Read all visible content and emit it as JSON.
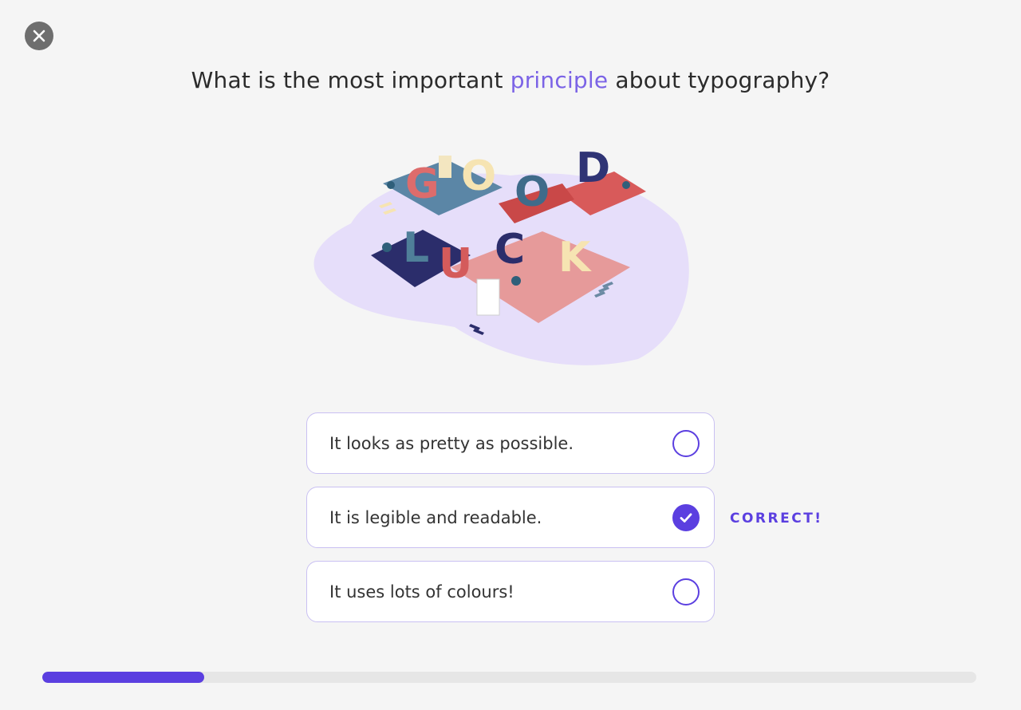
{
  "header": {
    "close_button": {
      "icon": "close-icon"
    }
  },
  "question": {
    "prefix": "What is the most important ",
    "highlight": "principle",
    "suffix": " about typography?"
  },
  "illustration": {
    "letters": [
      "G",
      "O",
      "O",
      "D",
      "L",
      "U",
      "C",
      "K"
    ]
  },
  "options": [
    {
      "label": "It looks as pretty as possible.",
      "selected": false
    },
    {
      "label": "It is legible and readable.",
      "selected": true,
      "feedback": "CORRECT!"
    },
    {
      "label": "It uses lots of colours!",
      "selected": false
    }
  ],
  "progress": {
    "fraction": 0.173
  },
  "colors": {
    "accent": "#5b3fe0",
    "highlight": "#7b63e6",
    "option_border": "#c9c0f2",
    "background": "#f5f5f5"
  }
}
